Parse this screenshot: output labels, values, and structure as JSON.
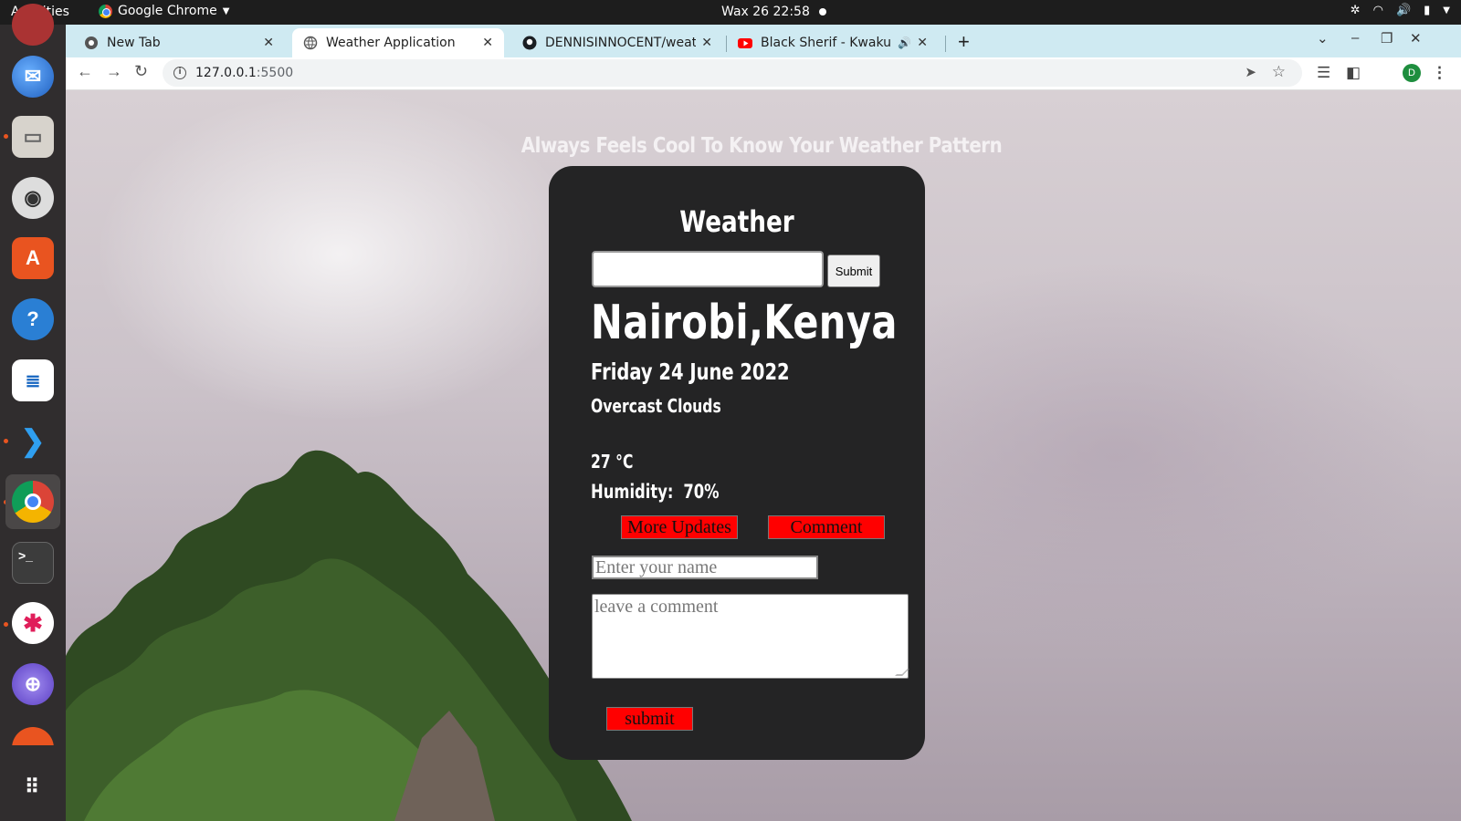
{
  "system": {
    "activities": "Activities",
    "app_name": "Google Chrome",
    "clock": "Wax 26  22:58"
  },
  "browser": {
    "tabs": [
      {
        "label": "New Tab",
        "icon": "chrome-icon"
      },
      {
        "label": "Weather Application",
        "icon": "globe-icon"
      },
      {
        "label": "DENNISINNOCENT/weat",
        "icon": "github-icon"
      },
      {
        "label": "Black Sherif - Kwaku th",
        "icon": "youtube-icon"
      }
    ],
    "url_host": "127.0.0.1",
    "url_port": ":5500",
    "profile_initial": "D"
  },
  "page": {
    "heading": "Always Feels Cool To Know Your Weather Pattern",
    "card_title": "Weather",
    "search": {
      "value": "",
      "placeholder": ""
    },
    "submit_label": "Submit",
    "city": "Nairobi,Kenya",
    "date": "Friday 24 June 2022",
    "condition": "Overcast Clouds",
    "temperature": "27 °C",
    "humidity_label": "Humidity:",
    "humidity_value": "70%",
    "more_updates_label": "More Updates",
    "comment_label": "Comment",
    "name_placeholder": "Enter your name",
    "comment_placeholder": "leave a comment",
    "submit_comment_label": "submit"
  },
  "colors": {
    "card_bg": "#242425",
    "button_red": "#ff0000",
    "tabbar_bg": "#cfeaf2"
  }
}
